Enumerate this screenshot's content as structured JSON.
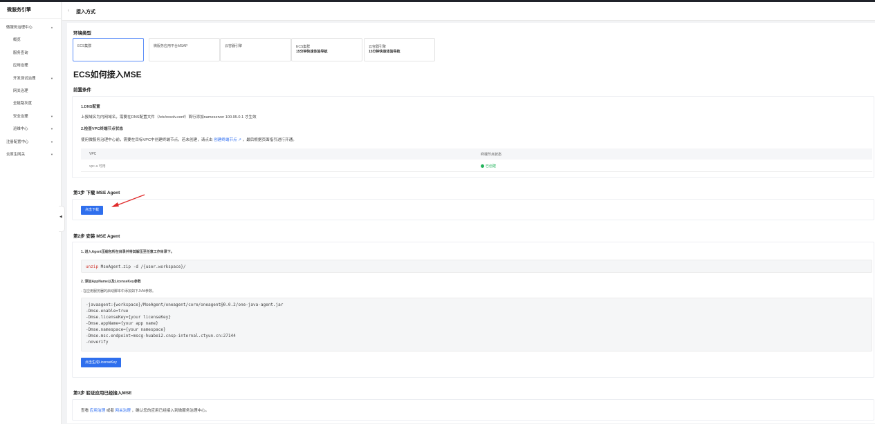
{
  "sidebar": {
    "brand": "微服务引擎",
    "items": [
      {
        "label": "微服务治理中心",
        "caret": "▲"
      },
      {
        "label": "概览"
      },
      {
        "label": "服务查询"
      },
      {
        "label": "应用治理"
      },
      {
        "label": "开发测试治理",
        "caret": "▼"
      },
      {
        "label": "网关治理"
      },
      {
        "label": "全链路灰度"
      },
      {
        "label": "安全治理",
        "caret": "▼"
      },
      {
        "label": "运维中心",
        "caret": "▼"
      },
      {
        "label": "注册配置中心",
        "caret": "▼"
      },
      {
        "label": "云原生网关",
        "caret": "▼"
      }
    ],
    "collapse_glyph": "◀"
  },
  "header": {
    "back_glyph": "‹",
    "title": "接入方式"
  },
  "env": {
    "label": "环境类型",
    "cards": [
      {
        "line1": "ECS集群",
        "line2": ""
      },
      {
        "line1": "微服务应用平台MSAP",
        "line2": ""
      },
      {
        "line1": "云容器引擎",
        "line2": ""
      },
      {
        "line1": "ECS集群",
        "line2": "15分钟快速体验导航"
      },
      {
        "line1": "云容器引擎",
        "line2": "15分钟快速体验导航"
      }
    ]
  },
  "page_title": "ECS如何接入MSE",
  "prereq": {
    "label": "前置条件",
    "dns_title": "1.DNS配置",
    "dns_text": "上报域名为内网域名，需要在DNS配置文件（/etc/resolv.conf）首行添加nameserver 100.95.0.1 才生效",
    "vpc_title": "2.检查VPC终端节点状态",
    "vpc_text_a": "使用微服务治理中心前，需要在目标VPC中创建终端节点，若未创建，请点击",
    "vpc_link": "创建终端节点",
    "vpc_text_b": "，最后根据页面指引进行开通。",
    "table": {
      "headers": [
        "VPC",
        "终端节点状态"
      ],
      "rows": [
        {
          "vpc": "vpc-a 可用",
          "status": "已创建"
        }
      ]
    }
  },
  "step1": {
    "title": "第1步 下载 MSE Agent",
    "button": "点击下载"
  },
  "step2": {
    "title": "第2步 安装 MSE Agent",
    "sub1": "1. 进入Agent压缩包所在目录并将其解压至任意工作目录下。",
    "cmd_kw": "unzip",
    "cmd_rest": " MseAgent.zip -d /{user.workspace}/",
    "sub2": "2. 添加AppName以及LicenseKey参数",
    "sub2_note": "- 在应用服务器的启动脚本中添加如下JVM参数。",
    "code_lines": [
      "-javaagent:{workspace}/MseAgent/oneagent/core/oneagent@0.0.2/one-java-agent.jar",
      "-Dmse.enable=true",
      "-Dmse.licenseKey={your licenseKey}",
      "-Dmse.appName={your app name}",
      "-Dmse.namespace={your namespace}",
      "-Dmse.msc.endpoint=mscg-huabei2.cnsp-internal.ctyun.cn:27144",
      "-noverify"
    ],
    "button": "点击生成LicenseKey"
  },
  "step3": {
    "title": "第3步 验证应用已经接入MSE",
    "text_a": "查看",
    "link1": "应用治理",
    "text_b": "或者",
    "link2": "网关治理",
    "text_c": "，确认您的应用已经接入到微服务治理中心。"
  },
  "colors": {
    "accent": "#2f6fed",
    "success": "#21b35a",
    "keyword": "#d0342c",
    "arrow": "#e02a2a"
  },
  "icons": [
    "back-arrow-icon",
    "caret-icon",
    "external-link-icon",
    "status-dot-icon",
    "collapse-icon",
    "red-arrow-annotation"
  ]
}
